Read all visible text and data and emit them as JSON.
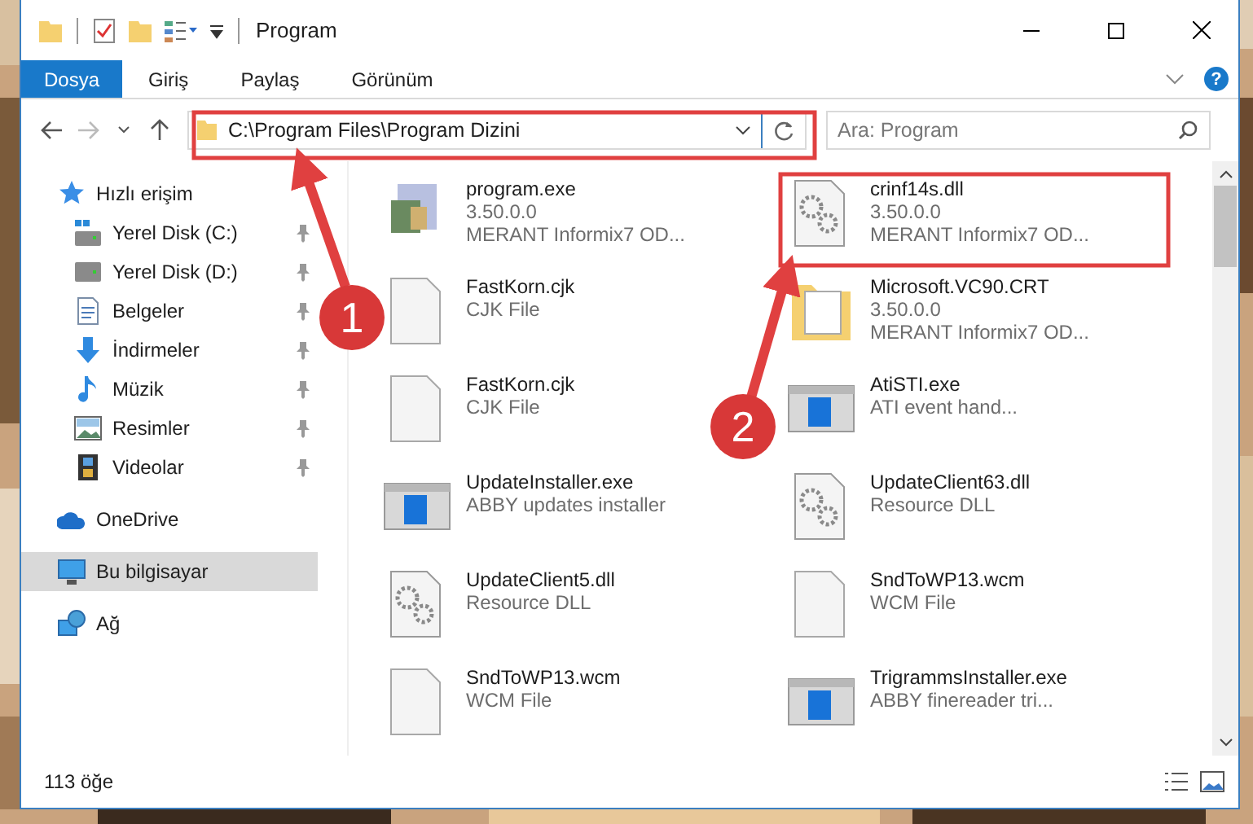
{
  "window": {
    "title": "Program"
  },
  "ribbon": {
    "tabs": [
      {
        "label": "Dosya",
        "selected": true
      },
      {
        "label": "Giriş",
        "selected": false
      },
      {
        "label": "Paylaş",
        "selected": false
      },
      {
        "label": "Görünüm",
        "selected": false
      }
    ],
    "help": "?"
  },
  "address": {
    "path": "C:\\Program Files\\Program Dizini"
  },
  "search": {
    "placeholder": "Ara: Program"
  },
  "nav": [
    {
      "label": "Hızlı erişim",
      "kind": "star",
      "selected": false,
      "children": [
        {
          "label": "Yerel Disk (C:)",
          "kind": "windrive",
          "pinned": true,
          "selected": false
        },
        {
          "label": "Yerel Disk (D:)",
          "kind": "drive",
          "pinned": true,
          "selected": false
        },
        {
          "label": "Belgeler",
          "kind": "docs",
          "pinned": true,
          "selected": false
        },
        {
          "label": "İndirmeler",
          "kind": "download",
          "pinned": true,
          "selected": false
        },
        {
          "label": "Müzik",
          "kind": "music",
          "pinned": true,
          "selected": false
        },
        {
          "label": "Resimler",
          "kind": "pictures",
          "pinned": true,
          "selected": false
        },
        {
          "label": "Videolar",
          "kind": "video",
          "pinned": true,
          "selected": false
        }
      ]
    },
    {
      "label": "OneDrive",
      "kind": "cloud",
      "selected": false
    },
    {
      "label": "Bu bilgisayar",
      "kind": "pc",
      "selected": true
    },
    {
      "label": "Ağ",
      "kind": "network",
      "selected": false
    }
  ],
  "files": [
    {
      "name": "program.exe",
      "kind": "app",
      "lines": [
        "3.50.0.0",
        "MERANT Informix7 OD..."
      ]
    },
    {
      "name": "crinf14s.dll",
      "kind": "gear",
      "lines": [
        "3.50.0.0",
        "MERANT Informix7 OD..."
      ]
    },
    {
      "name": "FastKorn.cjk",
      "kind": "blank",
      "lines": [
        "CJK File"
      ]
    },
    {
      "name": "Microsoft.VC90.CRT",
      "kind": "folder",
      "lines": [
        "3.50.0.0",
        "MERANT Informix7 OD..."
      ]
    },
    {
      "name": "FastKorn.cjk",
      "kind": "blank",
      "lines": [
        "CJK File"
      ]
    },
    {
      "name": "AtiSTI.exe",
      "kind": "window",
      "lines": [
        "ATI event hand..."
      ]
    },
    {
      "name": "UpdateInstaller.exe",
      "kind": "window",
      "lines": [
        "ABBY updates installer"
      ]
    },
    {
      "name": "UpdateClient63.dll",
      "kind": "gear",
      "lines": [
        "Resource DLL"
      ]
    },
    {
      "name": "UpdateClient5.dll",
      "kind": "gear",
      "lines": [
        "Resource DLL"
      ]
    },
    {
      "name": "SndToWP13.wcm",
      "kind": "blank",
      "lines": [
        "WCM File"
      ]
    },
    {
      "name": "SndToWP13.wcm",
      "kind": "blank",
      "lines": [
        "WCM File"
      ]
    },
    {
      "name": "TrigrammsInstaller.exe",
      "kind": "window",
      "lines": [
        "ABBY finereader tri..."
      ]
    }
  ],
  "status_bar": {
    "count": "113 öğe"
  },
  "callouts": [
    {
      "label": "1"
    },
    {
      "label": "2"
    }
  ]
}
